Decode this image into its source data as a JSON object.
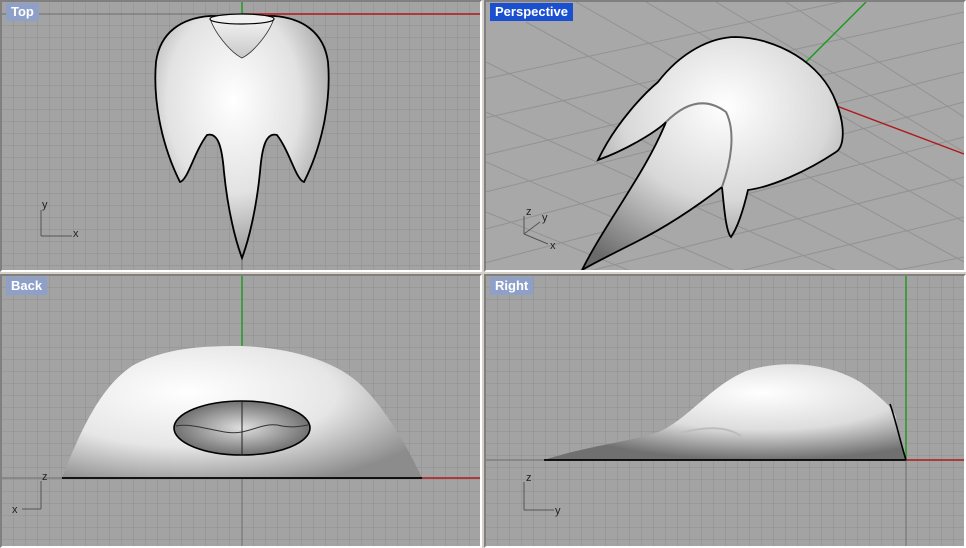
{
  "viewports": [
    {
      "id": "top",
      "title": "Top",
      "active": false,
      "axes": [
        "y",
        "x"
      ]
    },
    {
      "id": "perspective",
      "title": "Perspective",
      "active": true,
      "axes": [
        "z",
        "y",
        "x"
      ]
    },
    {
      "id": "back",
      "title": "Back",
      "active": false,
      "axes": [
        "z",
        "x"
      ]
    },
    {
      "id": "right",
      "title": "Right",
      "active": false,
      "axes": [
        "z",
        "y"
      ]
    }
  ],
  "colors": {
    "grid_bg": "#a3a3a3",
    "grid_minor": "#8f8f8f",
    "grid_major": "#6e6e6e",
    "axis_x": "#b01818",
    "axis_y": "#1a9a1a",
    "title_inactive": "#8fa0c8",
    "title_active": "#1a4fd0"
  },
  "icons": [
    "axis-triad-icon"
  ]
}
